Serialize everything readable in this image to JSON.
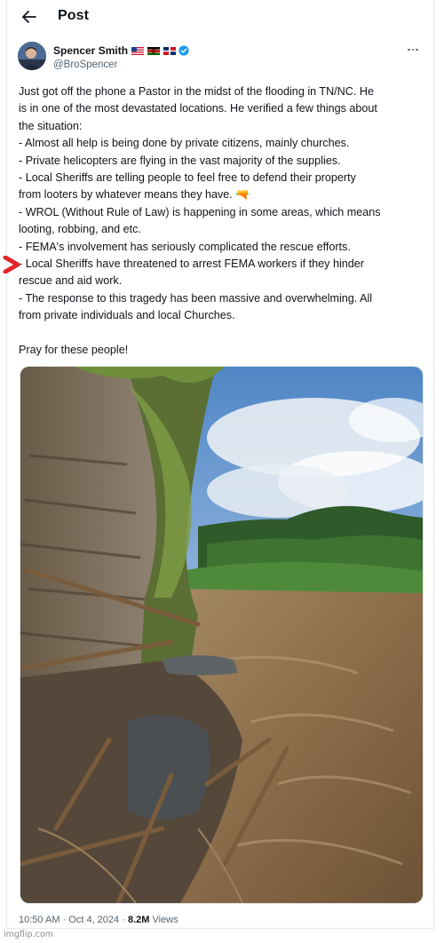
{
  "header": {
    "title": "Post"
  },
  "author": {
    "name": "Spencer Smith",
    "handle": "@BroSpencer",
    "flags": [
      "us-flag",
      "kenya-flag",
      "dominican-flag"
    ],
    "verified": true,
    "verified_color": "#1d9bf0"
  },
  "tweet": {
    "text": "Just got off the phone a Pastor in the midst of the flooding in TN/NC. He\nis in one of the most devastated locations. He verified a few things about\nthe situation:\n- Almost all help is being done by private citizens, mainly churches.\n- Private helicopters are flying in the vast majority of the supplies.\n- Local Sheriffs are telling people to feel free to defend their property\nfrom looters by whatever means they have. 🔫\n- WROL (Without Rule of Law) is happening in some areas, which means\nlooting, robbing, and etc.\n- FEMA's involvement has seriously complicated the rescue efforts.\n- Local Sheriffs have threatened to arrest FEMA workers if they hinder\nrescue and aid work.\n- The response to this tragedy has been massive and overwhelming. All\nfrom private individuals and local Churches.\n\nPray for these people!"
  },
  "meta": {
    "time": "10:50 AM",
    "separator": "·",
    "date": "Oct 4, 2024",
    "views_count": "8.2M",
    "views_label": "Views"
  },
  "annotation": {
    "arrow_color": "#e0242a"
  },
  "watermark": "imgflip.com"
}
